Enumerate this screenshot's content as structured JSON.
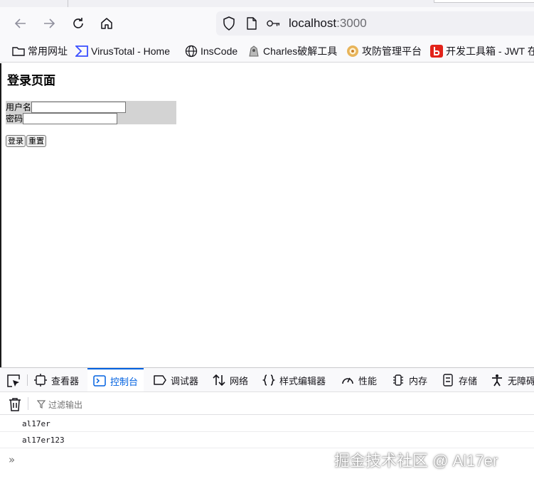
{
  "browser": {
    "url": {
      "host": "localhost",
      "port": ":3000"
    },
    "bookmarks": [
      {
        "label": "常用网址",
        "icon": "folder-icon"
      },
      {
        "label": "VirusTotal - Home",
        "icon": "virustotal-icon"
      },
      {
        "label": "InsCode",
        "icon": "globe-icon"
      },
      {
        "label": "Charles破解工具",
        "icon": "charles-icon"
      },
      {
        "label": "攻防管理平台",
        "icon": "shield-badge-icon"
      },
      {
        "label": "开发工具箱 - JWT 在",
        "icon": "devtools-box-icon"
      }
    ]
  },
  "page": {
    "title": "登录页面",
    "form": {
      "username_label": "用户名",
      "password_label": "密码",
      "username_value": "",
      "password_value": ""
    },
    "buttons": {
      "login": "登录",
      "reset": "重置"
    }
  },
  "devtools": {
    "tabs": [
      {
        "label": "查看器",
        "icon": "inspector-icon"
      },
      {
        "label": "控制台",
        "icon": "console-icon",
        "active": true
      },
      {
        "label": "调试器",
        "icon": "debugger-icon"
      },
      {
        "label": "网络",
        "icon": "network-icon"
      },
      {
        "label": "样式编辑器",
        "icon": "style-editor-icon"
      },
      {
        "label": "性能",
        "icon": "performance-icon"
      },
      {
        "label": "内存",
        "icon": "memory-icon"
      },
      {
        "label": "存储",
        "icon": "storage-icon"
      },
      {
        "label": "无障碍",
        "icon": "accessibility-icon"
      }
    ],
    "filter_placeholder": "过滤输出",
    "console_logs": [
      "al17er",
      "al17er123"
    ],
    "prompt": "»"
  },
  "watermark": "掘金技术社区 @ Al17er",
  "colors": {
    "accent": "#0061e0",
    "form_bg": "#d3d3d3"
  }
}
